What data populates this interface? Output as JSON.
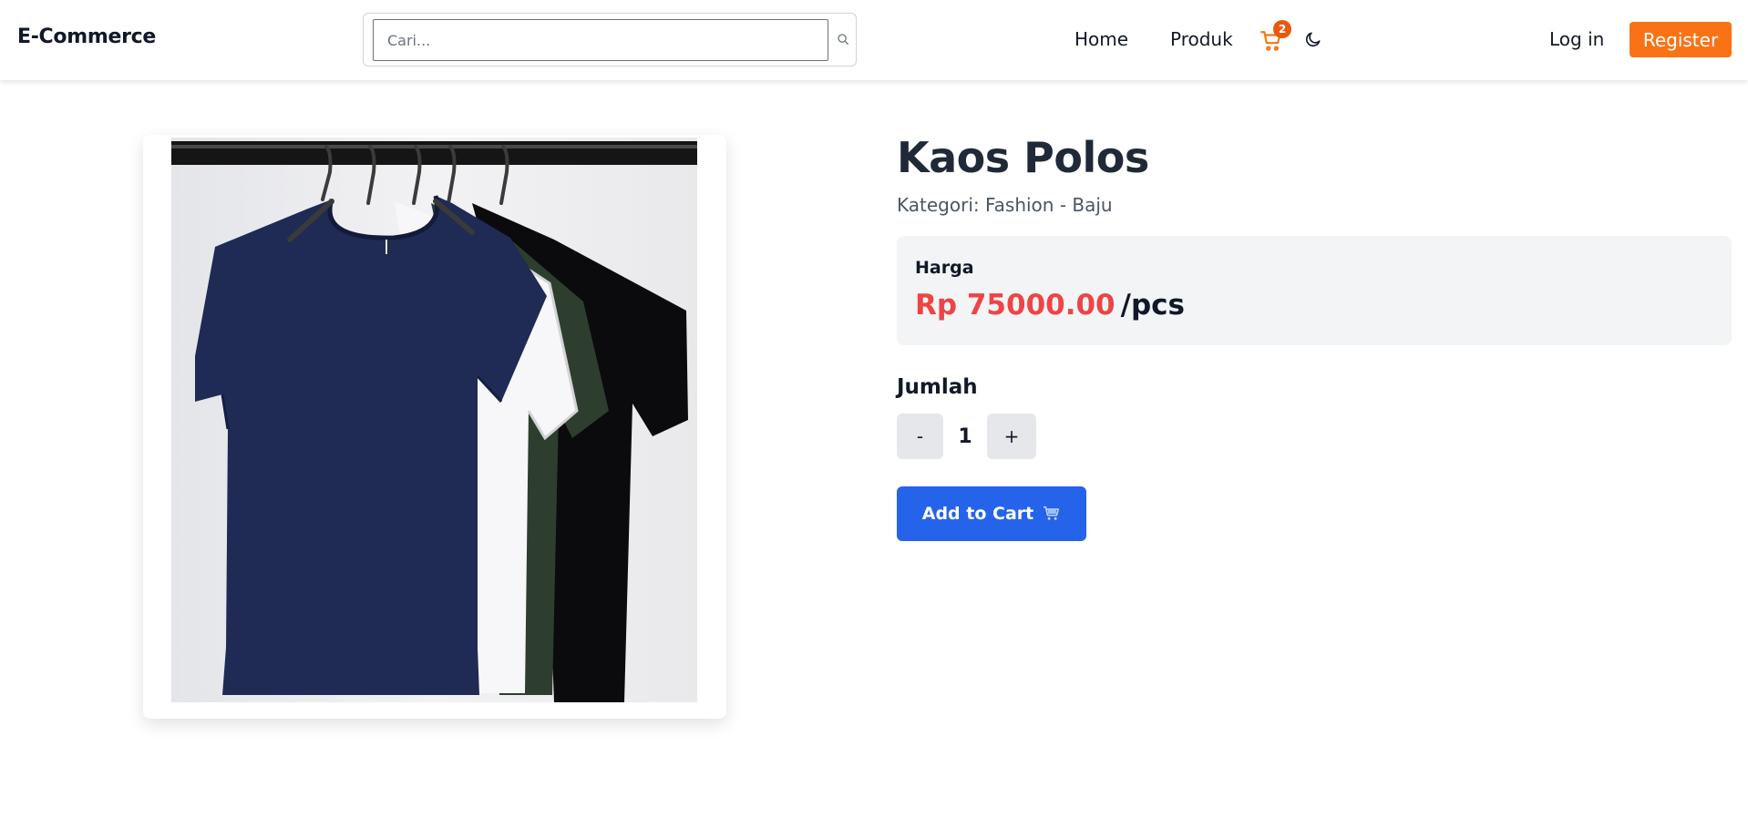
{
  "header": {
    "brand": "E-Commerce",
    "search": {
      "placeholder": "Cari...",
      "value": ""
    },
    "nav": {
      "home": "Home",
      "products": "Produk"
    },
    "cart_count": "2",
    "login": "Log in",
    "register": "Register"
  },
  "product": {
    "title": "Kaos Polos",
    "category": "Kategori: Fashion - Baju",
    "price_label": "Harga",
    "price": "Rp 75000.00",
    "price_unit": "/pcs",
    "quantity_label": "Jumlah",
    "quantity": "1",
    "minus_label": "-",
    "plus_label": "+",
    "add_to_cart": "Add to Cart"
  },
  "colors": {
    "accent": "#f97316",
    "price": "#ef4444",
    "primary_button": "#2563eb",
    "badge": "#ea580c"
  },
  "icons": {
    "search": "search-icon",
    "cart": "cart-icon",
    "theme": "moon-icon",
    "add_to_cart": "cart-icon"
  }
}
